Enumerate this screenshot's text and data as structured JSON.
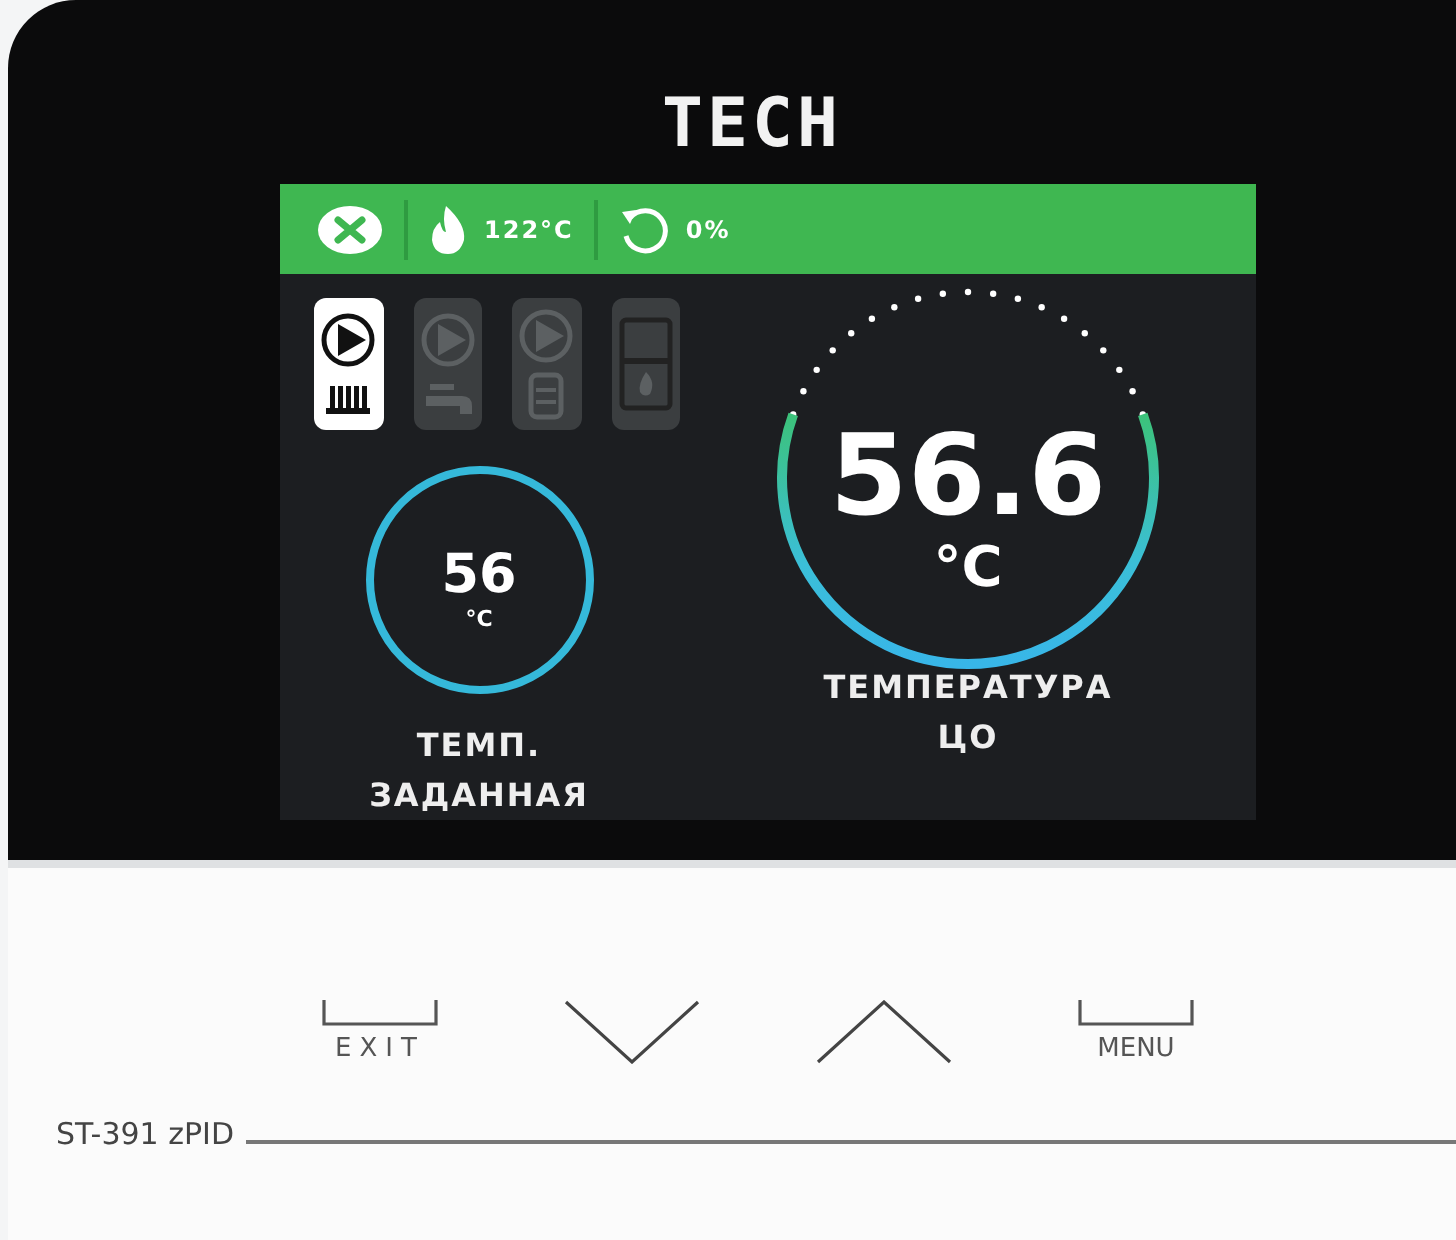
{
  "logo": "TECH",
  "status_bar": {
    "boiler_temperature": "122°C",
    "pump_power": "0%"
  },
  "modes": [
    {
      "kind": "radiator",
      "selected": true
    },
    {
      "kind": "tap",
      "selected": false
    },
    {
      "kind": "tank",
      "selected": false
    },
    {
      "kind": "boiler",
      "selected": false
    }
  ],
  "set_temperature": {
    "value": "56",
    "unit": "°C",
    "label": "ТЕМП.\nЗАДАННАЯ"
  },
  "current_temperature": {
    "value": "56.6",
    "unit": "°C",
    "label": "ТЕМПЕРАТУРА\nЦО"
  },
  "buttons": [
    {
      "kind": "exit",
      "label": "EXIT"
    },
    {
      "kind": "down"
    },
    {
      "kind": "up"
    },
    {
      "kind": "menu",
      "label": "MENU"
    }
  ],
  "model": "ST-391 zPID"
}
